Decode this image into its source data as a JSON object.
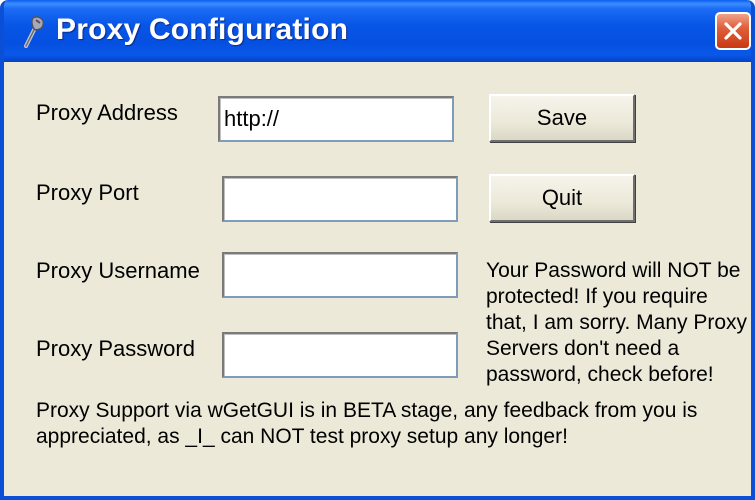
{
  "window": {
    "title": "Proxy Configuration",
    "title_icon": "wrench-icon",
    "close_icon": "close-icon"
  },
  "fields": {
    "address": {
      "label": "Proxy Address",
      "value": "http://"
    },
    "port": {
      "label": "Proxy Port",
      "value": ""
    },
    "username": {
      "label": "Proxy Username",
      "value": ""
    },
    "password": {
      "label": "Proxy Password",
      "value": ""
    }
  },
  "buttons": {
    "save": "Save",
    "quit": "Quit"
  },
  "password_note": "Your Password will NOT be protected! If you require that, I am sorry. Many Proxy Servers don't need a password, check before!",
  "footer_note": "Proxy Support via wGetGUI is in BETA stage, any feedback from you is appreciated, as _I_ can NOT test proxy setup any longer!",
  "colors": {
    "title_bar": "#0856e6",
    "window_bg": "#ece9d8",
    "close_button": "#e0603c"
  }
}
